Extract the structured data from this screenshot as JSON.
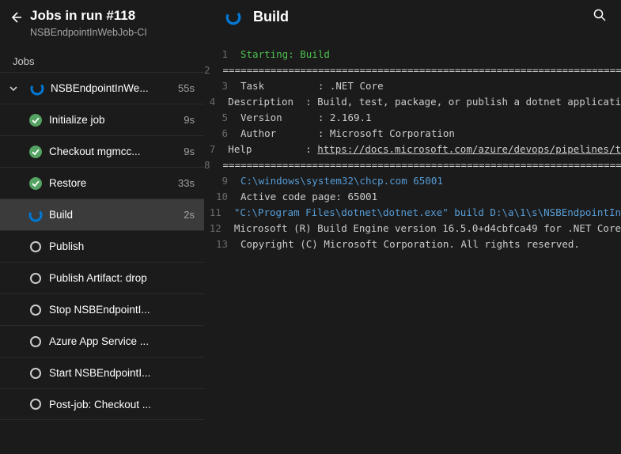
{
  "header": {
    "title": "Jobs in run #118",
    "subtitle": "NSBEndpointInWebJob-CI",
    "section": "Jobs"
  },
  "job": {
    "name": "NSBEndpointInWe...",
    "duration": "55s"
  },
  "steps": [
    {
      "label": "Initialize job",
      "duration": "9s",
      "status": "success"
    },
    {
      "label": "Checkout mgmcc...",
      "duration": "9s",
      "status": "success"
    },
    {
      "label": "Restore",
      "duration": "33s",
      "status": "success"
    },
    {
      "label": "Build",
      "duration": "2s",
      "status": "running",
      "selected": true
    },
    {
      "label": "Publish",
      "duration": "",
      "status": "pending"
    },
    {
      "label": "Publish Artifact: drop",
      "duration": "",
      "status": "pending"
    },
    {
      "label": "Stop NSBEndpointI...",
      "duration": "",
      "status": "pending"
    },
    {
      "label": "Azure App Service ...",
      "duration": "",
      "status": "pending"
    },
    {
      "label": "Start NSBEndpointI...",
      "duration": "",
      "status": "pending"
    },
    {
      "label": "Post-job: Checkout ...",
      "duration": "",
      "status": "pending"
    }
  ],
  "main": {
    "title": "Build"
  },
  "log": [
    {
      "n": 1,
      "text": "Starting: Build",
      "cls": "green"
    },
    {
      "n": 2,
      "text": "==============================================================================",
      "cls": ""
    },
    {
      "n": 3,
      "text": "Task         : .NET Core",
      "cls": ""
    },
    {
      "n": 4,
      "text": "Description  : Build, test, package, or publish a dotnet applicati",
      "cls": ""
    },
    {
      "n": 5,
      "text": "Version      : 2.169.1",
      "cls": ""
    },
    {
      "n": 6,
      "text": "Author       : Microsoft Corporation",
      "cls": ""
    },
    {
      "n": 7,
      "text": "Help         : ",
      "link": "https://docs.microsoft.com/azure/devops/pipelines/t",
      "cls": ""
    },
    {
      "n": 8,
      "text": "==============================================================================",
      "cls": ""
    },
    {
      "n": 9,
      "text": "C:\\windows\\system32\\chcp.com 65001",
      "cls": "blue"
    },
    {
      "n": 10,
      "text": "Active code page: 65001",
      "cls": ""
    },
    {
      "n": 11,
      "text": "\"C:\\Program Files\\dotnet\\dotnet.exe\" build D:\\a\\1\\s\\NSBEndpointIn",
      "cls": "blue"
    },
    {
      "n": 12,
      "text": "Microsoft (R) Build Engine version 16.5.0+d4cbfca49 for .NET Core",
      "cls": ""
    },
    {
      "n": 13,
      "text": "Copyright (C) Microsoft Corporation. All rights reserved.",
      "cls": ""
    }
  ]
}
